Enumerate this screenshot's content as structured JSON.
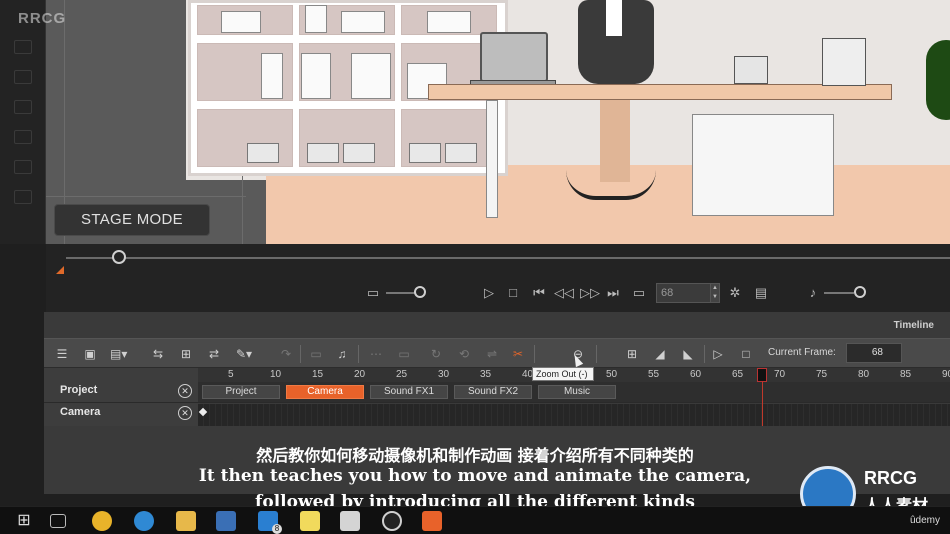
{
  "watermark": {
    "brand": "RRCG",
    "logo_text": "RRCG",
    "logo_sub": "人人素材"
  },
  "stage": {
    "mode_button_label": "STAGE MODE",
    "zoom_level_fraction": 0.06
  },
  "playback": {
    "buttons": [
      "play-icon",
      "stop-icon",
      "first-frame-icon",
      "previous-frame-icon",
      "next-frame-icon",
      "last-frame-icon",
      "loop-icon"
    ],
    "frame_value": "68",
    "settings_icon": "gear-icon",
    "render_icon": "film-icon"
  },
  "timeline": {
    "title": "Timeline",
    "current_frame_label": "Current Frame:",
    "current_frame_value": "68",
    "tooltip": "Zoom Out (-)",
    "ruler_ticks": [
      "5",
      "10",
      "15",
      "20",
      "25",
      "30",
      "35",
      "40",
      "45",
      "50",
      "55",
      "60",
      "65",
      "70",
      "75",
      "80",
      "85",
      "90"
    ],
    "tracks": [
      {
        "label": "Project",
        "close_symbol": "✕"
      },
      {
        "label": "Camera",
        "close_symbol": "✕"
      }
    ],
    "project_tabs": [
      {
        "label": "Project",
        "active": false
      },
      {
        "label": "Camera",
        "active": true
      },
      {
        "label": "Sound FX1",
        "active": false
      },
      {
        "label": "Sound FX2",
        "active": false
      },
      {
        "label": "Music",
        "active": false
      }
    ],
    "accent_color": "#e8622a"
  },
  "subtitles": {
    "chinese": "然后教你如何移动摄像机和制作动画 接着介绍所有不同种类的",
    "english_line1": "It then teaches you how to move and animate the camera,",
    "english_line2": "followed by introducing all the different kinds"
  },
  "taskbar": {
    "apps": [
      "windows-start-icon",
      "task-view-icon",
      "chrome-icon",
      "edge-icon",
      "file-explorer-icon",
      "store-icon",
      "mail-icon",
      "sticky-notes-icon",
      "paint-icon",
      "obs-icon",
      "cartoon-animator-icon"
    ],
    "mail_badge": "8",
    "udemy_label": "ûdemy"
  }
}
